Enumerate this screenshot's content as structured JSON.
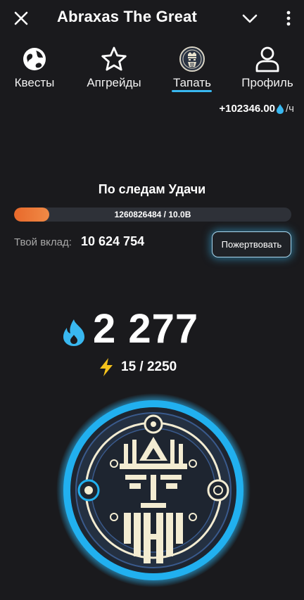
{
  "header": {
    "title": "Abraxas The Great",
    "close_icon": "close-icon",
    "dropdown_icon": "chevron-down-icon",
    "menu_icon": "more-vertical-icon"
  },
  "tabs": [
    {
      "label": "Квесты",
      "icon": "globe-icon",
      "active": false
    },
    {
      "label": "Апгрейды",
      "icon": "star-icon",
      "active": false
    },
    {
      "label": "Тапать",
      "icon": "abraxas-coin-icon",
      "active": true
    },
    {
      "label": "Профиль",
      "icon": "user-icon",
      "active": false
    }
  ],
  "income": {
    "value": "+102346.00",
    "unit": "/ч",
    "icon": "water-drop-icon"
  },
  "event": {
    "title": "По следам Удачи",
    "progress_text": "1260826484 / 10.0B",
    "progress_fraction": 0.126,
    "contribution_label": "Твой вклад:",
    "contribution_value": "10 624 754",
    "donate_label": "Пожертвовать"
  },
  "balance": {
    "value": "2 277",
    "icon": "water-drop-icon"
  },
  "energy": {
    "value": "15 / 2250",
    "icon": "lightning-bolt-icon"
  },
  "tap_coin": {
    "icon": "abraxas-face-emblem-icon"
  },
  "colors": {
    "background": "#1a1a1d",
    "accent_blue": "#39b8f0",
    "progress_orange": "#e8692b",
    "energy_yellow": "#f5c21b",
    "coin_cream": "#f3ecd2",
    "coin_dark": "#1e2530"
  }
}
